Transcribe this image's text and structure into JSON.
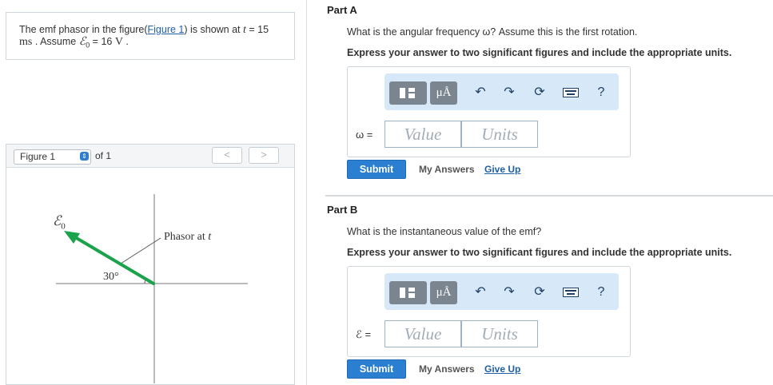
{
  "problem": {
    "text_before": "The emf phasor in the figure(",
    "figure_link": "Figure 1",
    "text_after": ") is shown at ",
    "t_symbol": "t",
    "t_value": " = 15",
    "ms_unit": "ms",
    "assume": " . Assume ",
    "emf_symbol": "ℰ",
    "emf_sub": "0",
    "emf_value": " = 16 ",
    "volt_unit": "V",
    "period": " ."
  },
  "figure": {
    "selector_label": "Figure 1",
    "of_text": "of 1",
    "prev_label": "<",
    "next_label": ">",
    "emf_label": "ℰ",
    "emf_label_sub": "0",
    "phasor_label": "Phasor at ",
    "phasor_label_t": "t",
    "angle_label": "30°",
    "arrow_color": "#1aa34a"
  },
  "partA": {
    "title": "Part A",
    "question": "What is the angular frequency ω? Assume this is the first rotation.",
    "instruction": "Express your answer to two significant figures and include the appropriate units.",
    "var_label": "ω =",
    "value_placeholder": "Value",
    "units_placeholder": "Units",
    "submit_label": "Submit",
    "my_answers_label": "My Answers",
    "give_up_label": "Give Up"
  },
  "partB": {
    "title": "Part B",
    "question": "What is the instantaneous value of the emf?",
    "instruction": "Express your answer to two significant figures and include the appropriate units.",
    "var_label": "ℰ =",
    "value_placeholder": "Value",
    "units_placeholder": "Units",
    "submit_label": "Submit",
    "my_answers_label": "My Answers",
    "give_up_label": "Give Up"
  },
  "toolbar": {
    "mu_label": "μÅ",
    "help_label": "?",
    "icons": [
      "templates-icon",
      "units-icon",
      "undo-icon",
      "redo-icon",
      "reset-icon",
      "keyboard-icon",
      "help-icon"
    ]
  },
  "colors": {
    "accent": "#2a7fd0",
    "link": "#1f5fa8",
    "toolbar_bg": "#d7e8f9",
    "placeholder": "#a3acb5"
  }
}
